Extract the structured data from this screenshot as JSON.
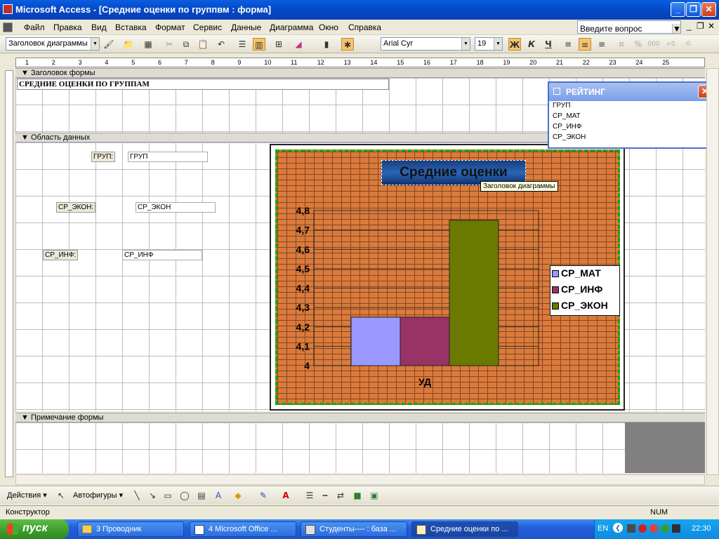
{
  "window": {
    "title": "Microsoft Access - [Средние оценки по группвм : форма]"
  },
  "menu": [
    "Файл",
    "Правка",
    "Вид",
    "Вставка",
    "Формат",
    "Сервис",
    "Данные",
    "Диаграмма",
    "Окно",
    "Справка"
  ],
  "help_search": {
    "placeholder": "Введите вопрос"
  },
  "toolbar": {
    "object_combo": "Заголовок диаграммы",
    "font_name": "Arial Cyr",
    "font_size": "19",
    "bold": "Ж",
    "italic": "К",
    "underline": "Ч"
  },
  "ruler": {
    "marks": [
      "1",
      "2",
      "3",
      "4",
      "5",
      "6",
      "7",
      "8",
      "9",
      "10",
      "11",
      "12",
      "13",
      "14",
      "15",
      "16",
      "17",
      "18",
      "19",
      "20",
      "21",
      "22",
      "23",
      "24",
      "25"
    ]
  },
  "sections": {
    "header": "Заголовок формы",
    "detail": "Область данных",
    "footer": "Примечание формы"
  },
  "form": {
    "heading": "СРЕДНИЕ ОЦЕНКИ ПО ГРУППАМ",
    "fields": [
      {
        "label": "ГРУП:",
        "value": "ГРУП"
      },
      {
        "label": "СР_ЭКОН:",
        "value": "СР_ЭКОН"
      },
      {
        "label": "СР_ИНФ:",
        "value": "СР_ИНФ"
      }
    ]
  },
  "fieldlist": {
    "title": "РЕЙТИНГ",
    "items": [
      "ГРУП",
      "СР_МАТ",
      "СР_ИНФ",
      "СР_ЭКОН"
    ]
  },
  "tooltip": "Заголовок диаграммы",
  "chart_data": {
    "type": "bar",
    "title": "Средние оценки",
    "categories": [
      "УД"
    ],
    "series": [
      {
        "name": "СР_МАТ",
        "values": [
          4.25
        ],
        "color": "#9999ff"
      },
      {
        "name": "СР_ИНФ",
        "values": [
          4.25
        ],
        "color": "#993366"
      },
      {
        "name": "СР_ЭКОН",
        "values": [
          4.75
        ],
        "color": "#6a7a00"
      }
    ],
    "ylim": [
      4,
      4.8
    ],
    "yticks": [
      "4",
      "4,1",
      "4,2",
      "4,3",
      "4,4",
      "4,5",
      "4,6",
      "4,7",
      "4,8"
    ],
    "xlabel": "",
    "ylabel": "",
    "grid": true,
    "legend": "right"
  },
  "drawbar": {
    "actions": "Действия",
    "autoshapes": "Автофигуры"
  },
  "status": {
    "mode": "Конструктор",
    "num": "NUM"
  },
  "taskbar": {
    "start": "пуск",
    "buttons": [
      "3 Проводник",
      "4 Microsoft Office ...",
      "Студенты---- : база ...",
      "Средние оценки по ..."
    ],
    "lang": "EN",
    "clock": "22:30"
  }
}
